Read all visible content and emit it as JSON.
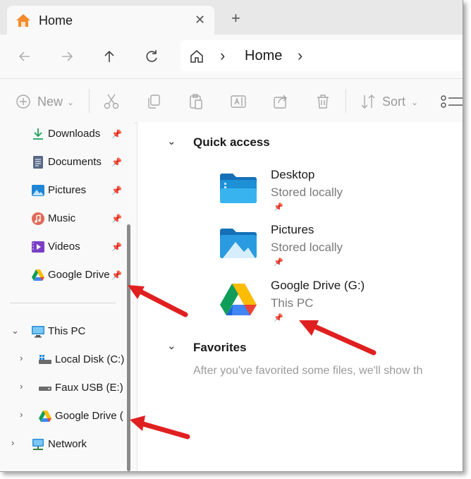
{
  "tab": {
    "title": "Home",
    "close_glyph": "✕",
    "new_tab_glyph": "+"
  },
  "nav": {
    "back_icon": "arrow-left-icon",
    "forward_icon": "arrow-right-icon",
    "up_icon": "arrow-up-icon",
    "refresh_icon": "refresh-icon",
    "address": {
      "location": "Home"
    }
  },
  "toolbar": {
    "new_label": "New",
    "sort_label": "Sort",
    "icons": [
      "cut-icon",
      "copy-icon",
      "paste-icon",
      "rename-icon",
      "share-icon",
      "delete-icon",
      "view-icon"
    ]
  },
  "sidebar": {
    "quick_items": [
      {
        "label": "Downloads",
        "icon": "download-icon",
        "pinned": true
      },
      {
        "label": "Documents",
        "icon": "documents-icon",
        "pinned": true
      },
      {
        "label": "Pictures",
        "icon": "pictures-icon",
        "pinned": true
      },
      {
        "label": "Music",
        "icon": "music-icon",
        "pinned": true
      },
      {
        "label": "Videos",
        "icon": "videos-icon",
        "pinned": true
      },
      {
        "label": "Google Drive",
        "icon": "google-drive-icon",
        "pinned": true
      }
    ],
    "this_pc": {
      "label": "This PC",
      "icon": "monitor-icon"
    },
    "drives": [
      {
        "label": "Local Disk (C:)",
        "icon": "local-disk-icon"
      },
      {
        "label": "Faux USB (E:)",
        "icon": "usb-drive-icon"
      },
      {
        "label": "Google Drive (",
        "icon": "google-drive-icon"
      }
    ],
    "network": {
      "label": "Network",
      "icon": "network-icon"
    }
  },
  "main": {
    "quick_access": {
      "title": "Quick access",
      "items": [
        {
          "name": "Desktop",
          "sub": "Stored locally",
          "icon": "desktop-folder-icon"
        },
        {
          "name": "Pictures",
          "sub": "Stored locally",
          "icon": "pictures-folder-icon"
        },
        {
          "name": "Google Drive (G:)",
          "sub": "This PC",
          "icon": "google-drive-icon"
        }
      ]
    },
    "favorites": {
      "title": "Favorites",
      "empty_message": "After you've favorited some files, we'll show th"
    }
  },
  "colors": {
    "accent": "#0078d4",
    "arrow": "#e02020",
    "folder": "#1e90d6"
  }
}
